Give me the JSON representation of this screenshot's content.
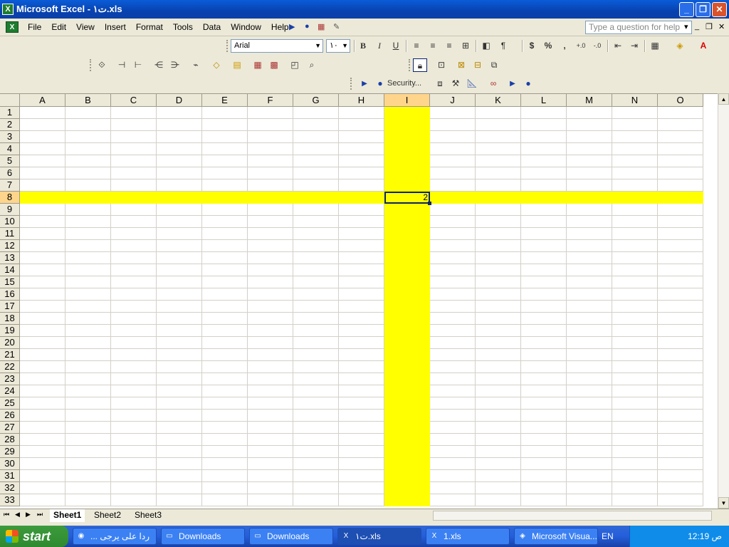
{
  "window": {
    "title": "Microsoft Excel - ت١.xls",
    "app_icon": "X"
  },
  "menu": {
    "items": [
      "File",
      "Edit",
      "View",
      "Insert",
      "Format",
      "Tools",
      "Data",
      "Window",
      "Help"
    ],
    "help_placeholder": "Type a question for help"
  },
  "formatting": {
    "font_name": "Arial",
    "font_size": "١٠"
  },
  "security_label": "Security...",
  "columns": [
    "A",
    "B",
    "C",
    "D",
    "E",
    "F",
    "G",
    "H",
    "I",
    "J",
    "K",
    "L",
    "M",
    "N",
    "O"
  ],
  "active_cell": {
    "column": "I",
    "row": 8,
    "value": "2"
  },
  "highlight_color": "#ffff00",
  "row_count": 33,
  "sheets": [
    "Sheet1",
    "Sheet2",
    "Sheet3"
  ],
  "active_sheet": "Sheet1",
  "taskbar": {
    "start": "start",
    "tasks": [
      {
        "label": "... ردا على يرجى",
        "icon": "chrome-icon",
        "active": false
      },
      {
        "label": "Downloads",
        "icon": "folder-icon",
        "active": false
      },
      {
        "label": "Downloads",
        "icon": "folder-icon",
        "active": false
      },
      {
        "label": "ت١.xls",
        "icon": "excel-icon",
        "active": true
      },
      {
        "label": "1.xls",
        "icon": "excel-icon",
        "active": false
      },
      {
        "label": "Microsoft Visua...",
        "icon": "vba-icon",
        "active": false
      }
    ],
    "language": "EN",
    "clock": "12:19 ص"
  }
}
